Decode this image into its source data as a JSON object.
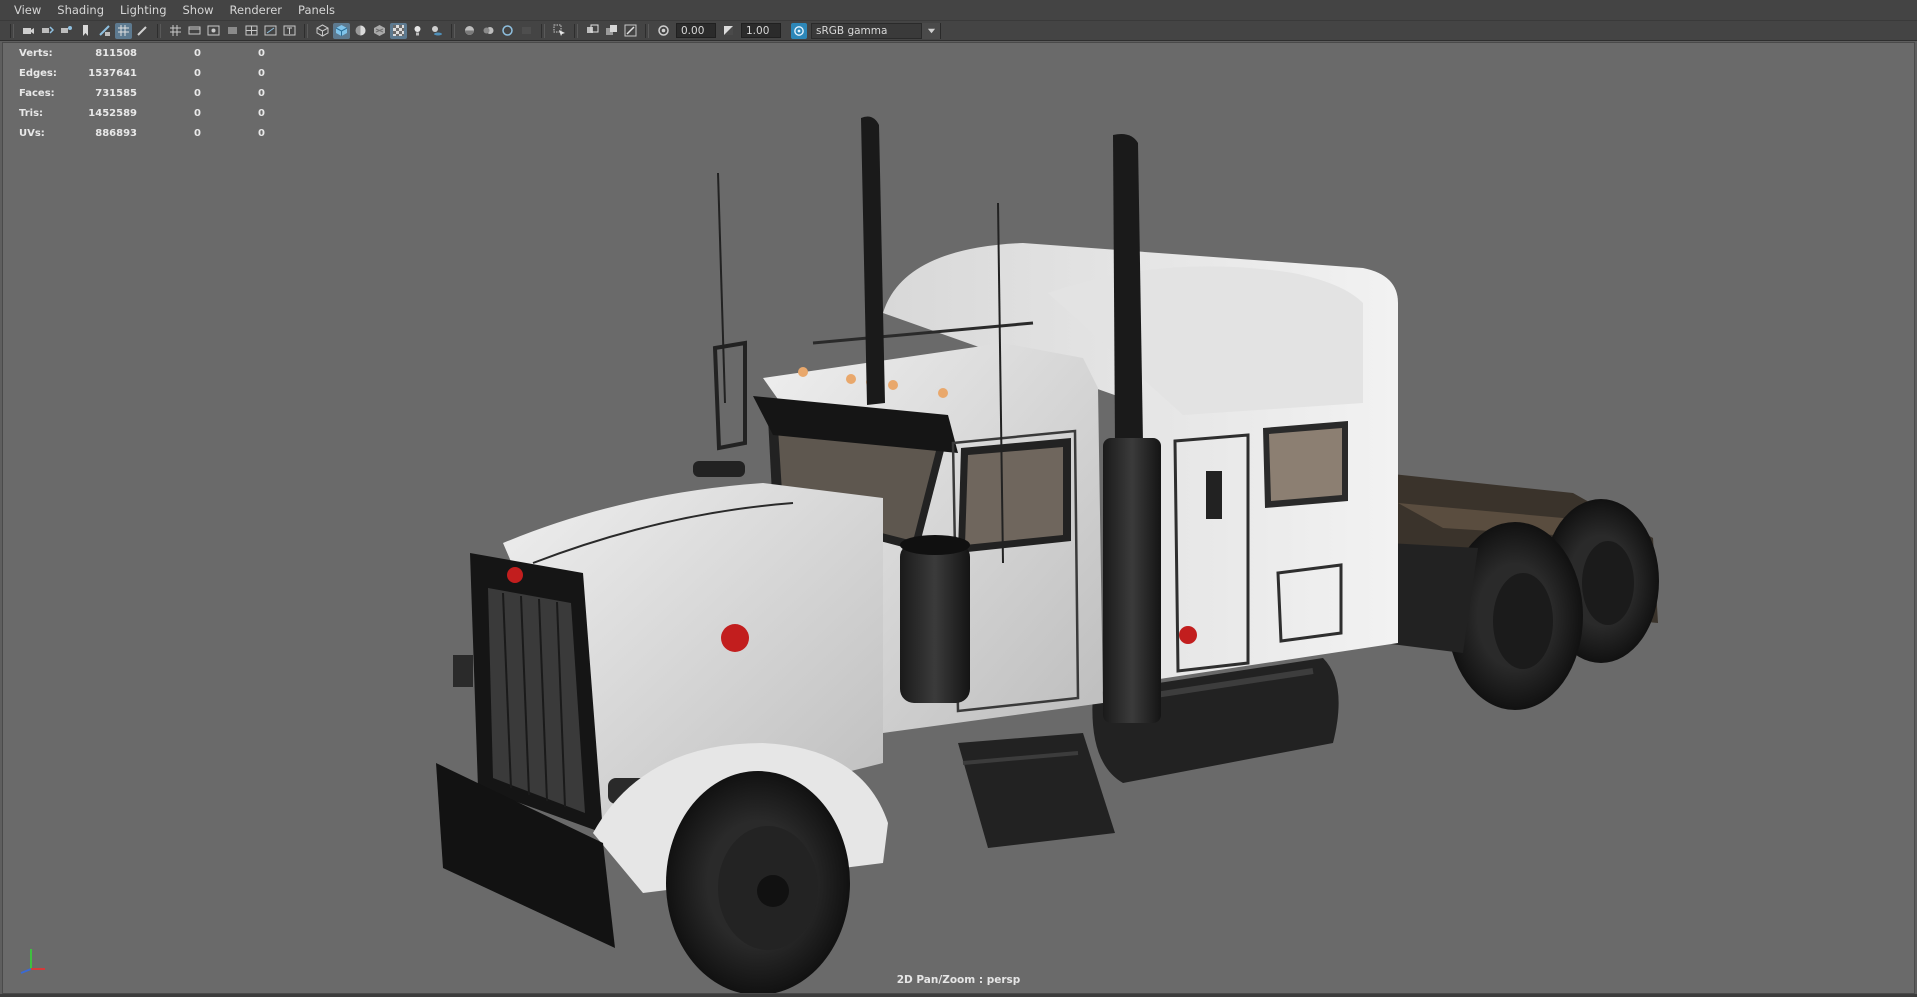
{
  "menu": {
    "items": [
      "View",
      "Shading",
      "Lighting",
      "Show",
      "Renderer",
      "Panels"
    ]
  },
  "toolbar": {
    "exposure": "0.00",
    "gamma": "1.00",
    "color_space": "sRGB gamma",
    "icons": [
      "camera-icon",
      "camera-attr-icon",
      "bookmark-icon",
      "image-plane-icon",
      "grid-icon",
      "film-gate-icon",
      "resolution-gate-icon",
      "gate-mask-icon",
      "field-chart-icon",
      "safe-action-icon",
      "safe-title-icon",
      "wireframe-icon",
      "smooth-shade-icon",
      "default-material-icon",
      "textured-icon",
      "use-lights-icon",
      "shadows-icon",
      "screen-space-ao-icon",
      "motion-blur-icon",
      "anti-alias-icon",
      "depth-of-field-icon",
      "isolate-select-icon",
      "xray-icon",
      "xray-active-icon",
      "xray-joints-icon",
      "exposure-icon",
      "gamma-icon",
      "color-management-icon"
    ],
    "accent": "#5d7a90"
  },
  "hud": {
    "rows": [
      {
        "label": "Verts:",
        "v1": "811508",
        "v2": "0",
        "v3": "0"
      },
      {
        "label": "Edges:",
        "v1": "1537641",
        "v2": "0",
        "v3": "0"
      },
      {
        "label": "Faces:",
        "v1": "731585",
        "v2": "0",
        "v3": "0"
      },
      {
        "label": "Tris:",
        "v1": "1452589",
        "v2": "0",
        "v3": "0"
      },
      {
        "label": "UVs:",
        "v1": "886893",
        "v2": "0",
        "v3": "0"
      }
    ]
  },
  "viewport": {
    "camera_label": "2D Pan/Zoom : persp",
    "background": "#6a6a6a",
    "subject": "semi-truck-model"
  }
}
